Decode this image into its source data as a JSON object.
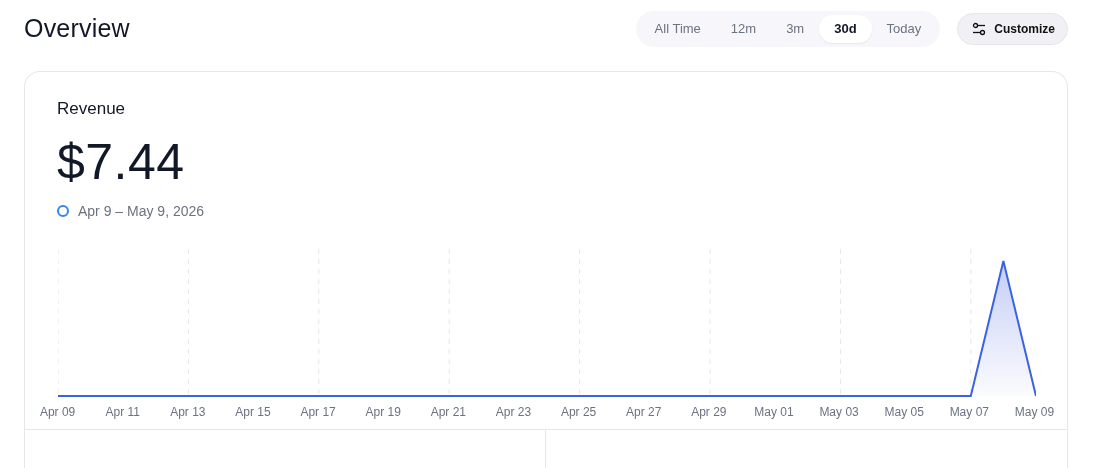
{
  "page": {
    "title": "Overview"
  },
  "ranges": [
    {
      "label": "All Time",
      "selected": false
    },
    {
      "label": "12m",
      "selected": false
    },
    {
      "label": "3m",
      "selected": false
    },
    {
      "label": "30d",
      "selected": true
    },
    {
      "label": "Today",
      "selected": false
    }
  ],
  "customize_button": {
    "label": "Customize"
  },
  "revenue_card": {
    "title": "Revenue",
    "value": "$7.44",
    "legend": {
      "label": "Apr 9 – May 9, 2026",
      "color": "#3b82f6"
    },
    "x_labels": [
      "Apr 09",
      "Apr 11",
      "Apr 13",
      "Apr 15",
      "Apr 17",
      "Apr 19",
      "Apr 21",
      "Apr 23",
      "Apr 25",
      "Apr 27",
      "Apr 29",
      "May 01",
      "May 03",
      "May 05",
      "May 07",
      "May 09"
    ]
  }
}
